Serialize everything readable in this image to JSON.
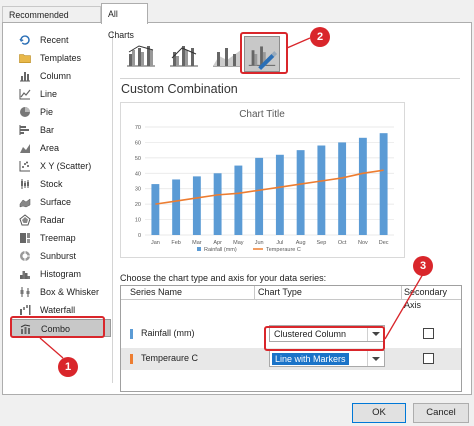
{
  "tabs": [
    {
      "label": "Recommended Charts"
    },
    {
      "label": "All Charts"
    }
  ],
  "sidebar": {
    "items": [
      {
        "label": "Recent",
        "icon": "recent-icon"
      },
      {
        "label": "Templates",
        "icon": "folder-icon"
      },
      {
        "label": "Column",
        "icon": "column-chart-icon"
      },
      {
        "label": "Line",
        "icon": "line-chart-icon"
      },
      {
        "label": "Pie",
        "icon": "pie-chart-icon"
      },
      {
        "label": "Bar",
        "icon": "bar-chart-icon"
      },
      {
        "label": "Area",
        "icon": "area-chart-icon"
      },
      {
        "label": "X Y (Scatter)",
        "icon": "scatter-chart-icon"
      },
      {
        "label": "Stock",
        "icon": "stock-chart-icon"
      },
      {
        "label": "Surface",
        "icon": "surface-chart-icon"
      },
      {
        "label": "Radar",
        "icon": "radar-chart-icon"
      },
      {
        "label": "Treemap",
        "icon": "treemap-icon"
      },
      {
        "label": "Sunburst",
        "icon": "sunburst-icon"
      },
      {
        "label": "Histogram",
        "icon": "histogram-icon"
      },
      {
        "label": "Box & Whisker",
        "icon": "box-whisker-icon"
      },
      {
        "label": "Waterfall",
        "icon": "waterfall-icon"
      },
      {
        "label": "Combo",
        "icon": "combo-chart-icon",
        "selected": true
      }
    ]
  },
  "section_title": "Custom Combination",
  "chart_data": {
    "type": "bar",
    "title": "Chart Title",
    "categories": [
      "Jan",
      "Feb",
      "Mar",
      "Apr",
      "May",
      "Jun",
      "Jul",
      "Aug",
      "Sep",
      "Oct",
      "Nov",
      "Dec"
    ],
    "series": [
      {
        "name": "Rainfall (mm)",
        "type": "bar",
        "color": "#5b9bd5",
        "values": [
          33,
          36,
          38,
          40,
          45,
          50,
          52,
          55,
          58,
          60,
          63,
          66
        ]
      },
      {
        "name": "Temperaure C",
        "type": "line",
        "color": "#ed7d31",
        "values": [
          20,
          22,
          24,
          26,
          27,
          29,
          31,
          33,
          35,
          37,
          40,
          42
        ]
      }
    ],
    "ylim": [
      0,
      70
    ],
    "yticks": [
      "0",
      "10",
      "20",
      "30",
      "40",
      "50",
      "60",
      "70"
    ],
    "grid": true,
    "legend": "bottom"
  },
  "series_prompt": "Choose the chart type and axis for your data series:",
  "table": {
    "headers": {
      "name": "Series Name",
      "type": "Chart Type",
      "axis": "Secondary Axis"
    },
    "rows": [
      {
        "name": "Rainfall (mm)",
        "type": "Clustered Column",
        "color": "#5b9bd5"
      },
      {
        "name": "Temperaure C",
        "type": "Line with Markers",
        "color": "#ed7d31"
      }
    ]
  },
  "buttons": {
    "ok": "OK",
    "cancel": "Cancel"
  },
  "callouts": [
    "1",
    "2",
    "3"
  ],
  "colors": {
    "accent": "#d9262b",
    "selection": "#1a73c8"
  }
}
